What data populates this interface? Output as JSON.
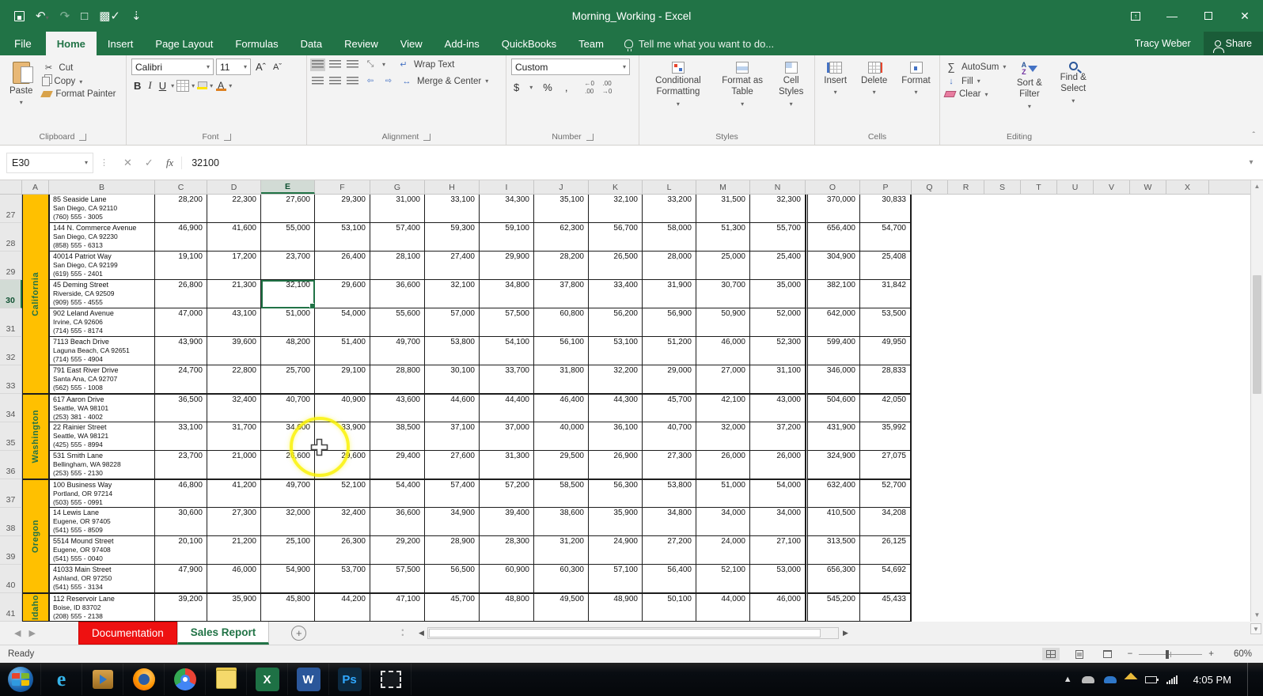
{
  "title_bar": {
    "title": "Morning_Working - Excel"
  },
  "ribbon_tabs": {
    "items": [
      "File",
      "Home",
      "Insert",
      "Page Layout",
      "Formulas",
      "Data",
      "Review",
      "View",
      "Add-ins",
      "QuickBooks",
      "Team"
    ],
    "active": "Home",
    "tell_me": "Tell me what you want to do...",
    "user_name": "Tracy Weber",
    "share_label": "Share"
  },
  "ribbon": {
    "clipboard": {
      "label": "Clipboard",
      "paste": "Paste",
      "cut": "Cut",
      "copy": "Copy",
      "format_painter": "Format Painter"
    },
    "font": {
      "label": "Font",
      "font_name": "Calibri",
      "font_size": "11",
      "bold": "B",
      "italic": "I",
      "underline": "U"
    },
    "alignment": {
      "label": "Alignment",
      "wrap_text": "Wrap Text",
      "merge_center": "Merge & Center"
    },
    "number": {
      "label": "Number",
      "format": "Custom",
      "currency": "$",
      "percent": "%",
      "comma": ","
    },
    "styles": {
      "label": "Styles",
      "conditional": "Conditional Formatting",
      "format_table": "Format as Table",
      "cell_styles": "Cell Styles"
    },
    "cells": {
      "label": "Cells",
      "insert": "Insert",
      "delete": "Delete",
      "format": "Format"
    },
    "editing": {
      "label": "Editing",
      "autosum": "AutoSum",
      "fill": "Fill",
      "clear": "Clear",
      "sort_filter": "Sort & Filter",
      "find_select": "Find & Select"
    }
  },
  "formula_bar": {
    "name_box": "E30",
    "value": "32100"
  },
  "sheet": {
    "columns": [
      "A",
      "B",
      "C",
      "D",
      "E",
      "F",
      "G",
      "H",
      "I",
      "J",
      "K",
      "L",
      "M",
      "N",
      "O",
      "P",
      "Q",
      "R",
      "S",
      "T",
      "U",
      "V",
      "W",
      "X"
    ],
    "selected_column": "E",
    "selected_row": 30,
    "selected_cell": "E30",
    "state_groups": [
      {
        "label": "California",
        "first_row": 27,
        "last_row": 33,
        "continues_above": true
      },
      {
        "label": "Washington",
        "first_row": 34,
        "last_row": 36,
        "continues_above": false
      },
      {
        "label": "Oregon",
        "first_row": 37,
        "last_row": 40,
        "continues_above": false
      },
      {
        "label": "Idaho",
        "first_row": 41,
        "last_row": 41,
        "continues_above": false
      }
    ],
    "rows": [
      {
        "num": 27,
        "address": [
          "85 Seaside Lane",
          "San Diego, CA 92110",
          "(760) 555 - 3005"
        ],
        "values": [
          "28,200",
          "22,300",
          "27,600",
          "29,300",
          "31,000",
          "33,100",
          "34,300",
          "35,100",
          "32,100",
          "33,200",
          "31,500",
          "32,300",
          "370,000",
          "30,833"
        ]
      },
      {
        "num": 28,
        "address": [
          "144 N. Commerce Avenue",
          "San Diego, CA 92230",
          "(858) 555 - 6313"
        ],
        "values": [
          "46,900",
          "41,600",
          "55,000",
          "53,100",
          "57,400",
          "59,300",
          "59,100",
          "62,300",
          "56,700",
          "58,000",
          "51,300",
          "55,700",
          "656,400",
          "54,700"
        ]
      },
      {
        "num": 29,
        "address": [
          "40014 Patriot Way",
          "San Diego, CA 92199",
          "(619) 555 - 2401"
        ],
        "values": [
          "19,100",
          "17,200",
          "23,700",
          "26,400",
          "28,100",
          "27,400",
          "29,900",
          "28,200",
          "26,500",
          "28,000",
          "25,000",
          "25,400",
          "304,900",
          "25,408"
        ]
      },
      {
        "num": 30,
        "address": [
          "45 Deming Street",
          "Riverside, CA 92509",
          "(909) 555 - 4555"
        ],
        "values": [
          "26,800",
          "21,300",
          "32,100",
          "29,600",
          "36,600",
          "32,100",
          "34,800",
          "37,800",
          "33,400",
          "31,900",
          "30,700",
          "35,000",
          "382,100",
          "31,842"
        ]
      },
      {
        "num": 31,
        "address": [
          "902 Leland Avenue",
          "Irvine, CA 92606",
          "(714) 555 - 8174"
        ],
        "values": [
          "47,000",
          "43,100",
          "51,000",
          "54,000",
          "55,600",
          "57,000",
          "57,500",
          "60,800",
          "56,200",
          "56,900",
          "50,900",
          "52,000",
          "642,000",
          "53,500"
        ]
      },
      {
        "num": 32,
        "address": [
          "7113 Beach Drive",
          "Laguna Beach, CA 92651",
          "(714) 555 - 4904"
        ],
        "values": [
          "43,900",
          "39,600",
          "48,200",
          "51,400",
          "49,700",
          "53,800",
          "54,100",
          "56,100",
          "53,100",
          "51,200",
          "46,000",
          "52,300",
          "599,400",
          "49,950"
        ]
      },
      {
        "num": 33,
        "address": [
          "791 East River Drive",
          "Santa Ana, CA 92707",
          "(562) 555 - 1008"
        ],
        "values": [
          "24,700",
          "22,800",
          "25,700",
          "29,100",
          "28,800",
          "30,100",
          "33,700",
          "31,800",
          "32,200",
          "29,000",
          "27,000",
          "31,100",
          "346,000",
          "28,833"
        ]
      },
      {
        "num": 34,
        "address": [
          "617 Aaron Drive",
          "Seattle, WA 98101",
          "(253) 381 - 4002"
        ],
        "values": [
          "36,500",
          "32,400",
          "40,700",
          "40,900",
          "43,600",
          "44,600",
          "44,400",
          "46,400",
          "44,300",
          "45,700",
          "42,100",
          "43,000",
          "504,600",
          "42,050"
        ]
      },
      {
        "num": 35,
        "address": [
          "22 Rainier Street",
          "Seattle, WA 98121",
          "(425) 555 - 8994"
        ],
        "values": [
          "33,100",
          "31,700",
          "34,600",
          "33,900",
          "38,500",
          "37,100",
          "37,000",
          "40,000",
          "36,100",
          "40,700",
          "32,000",
          "37,200",
          "431,900",
          "35,992"
        ]
      },
      {
        "num": 36,
        "address": [
          "531 Smith Lane",
          "Bellingham, WA 98228",
          "(253) 555 - 2130"
        ],
        "values": [
          "23,700",
          "21,000",
          "26,600",
          "29,600",
          "29,400",
          "27,600",
          "31,300",
          "29,500",
          "26,900",
          "27,300",
          "26,000",
          "26,000",
          "324,900",
          "27,075"
        ]
      },
      {
        "num": 37,
        "address": [
          "100 Business Way",
          "Portland, OR 97214",
          "(503) 555 - 0991"
        ],
        "values": [
          "46,800",
          "41,200",
          "49,700",
          "52,100",
          "54,400",
          "57,400",
          "57,200",
          "58,500",
          "56,300",
          "53,800",
          "51,000",
          "54,000",
          "632,400",
          "52,700"
        ]
      },
      {
        "num": 38,
        "address": [
          "14 Lewis Lane",
          "Eugene, OR 97405",
          "(541) 555 - 8509"
        ],
        "values": [
          "30,600",
          "27,300",
          "32,000",
          "32,400",
          "36,600",
          "34,900",
          "39,400",
          "38,600",
          "35,900",
          "34,800",
          "34,000",
          "34,000",
          "410,500",
          "34,208"
        ]
      },
      {
        "num": 39,
        "address": [
          "5514 Mound Street",
          "Eugene, OR 97408",
          "(541) 555 - 0040"
        ],
        "values": [
          "20,100",
          "21,200",
          "25,100",
          "26,300",
          "29,200",
          "28,900",
          "28,300",
          "31,200",
          "24,900",
          "27,200",
          "24,000",
          "27,100",
          "313,500",
          "26,125"
        ]
      },
      {
        "num": 40,
        "address": [
          "41033 Main Street",
          "Ashland, OR 97250",
          "(541) 555 - 3134"
        ],
        "values": [
          "47,900",
          "46,000",
          "54,900",
          "53,700",
          "57,500",
          "56,500",
          "60,900",
          "60,300",
          "57,100",
          "56,400",
          "52,100",
          "53,000",
          "656,300",
          "54,692"
        ]
      },
      {
        "num": 41,
        "address": [
          "112 Reservoir Lane",
          "Boise, ID 83702",
          "(208) 555 - 2138"
        ],
        "values": [
          "39,200",
          "35,900",
          "45,800",
          "44,200",
          "47,100",
          "45,700",
          "48,800",
          "49,500",
          "48,900",
          "50,100",
          "44,000",
          "46,000",
          "545,200",
          "45,433"
        ]
      }
    ]
  },
  "annotation": {
    "shape": "circle",
    "color": "#faf200",
    "cursor": "excel-cell-cross"
  },
  "sheet_tabs": {
    "tabs": [
      {
        "label": "Documentation",
        "style": "red",
        "active": false
      },
      {
        "label": "Sales Report",
        "style": "normal",
        "active": true
      }
    ]
  },
  "status_bar": {
    "mode": "Ready",
    "zoom": "60%"
  },
  "taskbar": {
    "clock": "4:05 PM",
    "icons": [
      "start",
      "internet-explorer",
      "media-player",
      "firefox",
      "chrome",
      "sticky-notes",
      "excel",
      "word",
      "photoshop",
      "snip-region"
    ],
    "app_glyphs": {
      "excel": "X",
      "word": "W",
      "photoshop": "Ps"
    },
    "colors": {
      "excel_green": "#1e7145",
      "word_blue": "#2b579a",
      "ps_bg": "#0c2940",
      "ps_text": "#31a8ff"
    }
  },
  "theme": {
    "excel_green": "#217346",
    "band_gold": "#ffc000",
    "doc_tab_red": "#ee1111"
  }
}
